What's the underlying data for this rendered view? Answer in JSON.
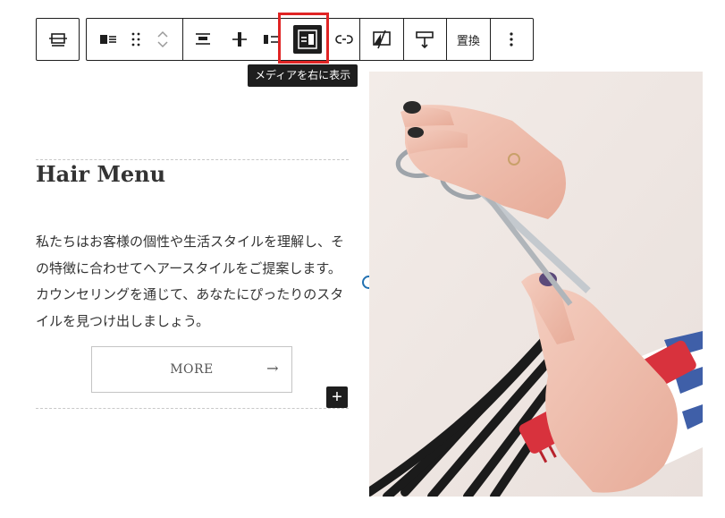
{
  "toolbar": {
    "tooltip": "メディアを右に表示",
    "replace_label": "置換",
    "buttons": [
      "block-type-icon",
      "media-text-icon",
      "drag-handle-icon",
      "move-up-icon",
      "move-down-icon",
      "align-top-icon",
      "align-center-icon",
      "align-bottom-icon",
      "media-right-icon",
      "link-icon",
      "crop-icon",
      "height-icon",
      "more-options-icon"
    ]
  },
  "content": {
    "heading": "Hair Menu",
    "body": "私たちはお客様の個性や生活スタイルを理解し、その特徴に合わせてヘアースタイルをご提案します。カウンセリングを通じて、あなたにぴったりのスタイルを見つけ出しましょう。",
    "button_label": "MORE",
    "button_arrow": "→",
    "add_symbol": "+"
  },
  "colors": {
    "highlight": "#e02424",
    "active_button": "#1e1e1e",
    "handle": "#2271b1"
  }
}
